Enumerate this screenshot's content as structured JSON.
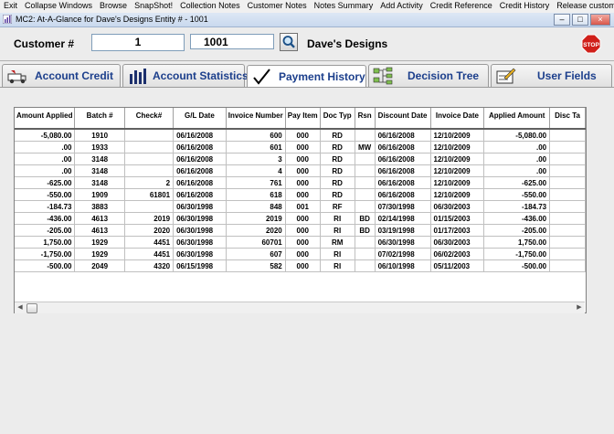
{
  "menu": [
    "Exit",
    "Collapse Windows",
    "Browse",
    "SnapShot!",
    "Collection Notes",
    "Customer Notes",
    "Notes Summary",
    "Add Activity",
    "Credit Reference",
    "Credit History",
    "Release customer from Hold - C"
  ],
  "window": {
    "title": "MC2: At-A-Glance for Dave's Designs     Entity # - 1001"
  },
  "customer": {
    "label": "Customer #",
    "number": "1",
    "entity": "1001",
    "name": "Dave's Designs"
  },
  "tabs": [
    {
      "label": "Account Credit"
    },
    {
      "label": "Account Statistics"
    },
    {
      "label": "Payment History"
    },
    {
      "label": "Decision Tree"
    },
    {
      "label": "User Fields"
    }
  ],
  "grid": {
    "columns": [
      "Amount Applied",
      "Batch #",
      "Check#",
      "G/L Date",
      "Invoice Number",
      "Pay Item",
      "Doc Typ",
      "Rsn",
      "Discount Date",
      "Invoice Date",
      "Applied Amount",
      "Disc Ta"
    ],
    "rows": [
      [
        "-5,080.00",
        "1910",
        "",
        "06/16/2008",
        "600",
        "000",
        "RD",
        "",
        "06/16/2008",
        "12/10/2009",
        "-5,080.00",
        ""
      ],
      [
        ".00",
        "1933",
        "",
        "06/16/2008",
        "601",
        "000",
        "RD",
        "MW",
        "06/16/2008",
        "12/10/2009",
        ".00",
        ""
      ],
      [
        ".00",
        "3148",
        "",
        "06/16/2008",
        "3",
        "000",
        "RD",
        "",
        "06/16/2008",
        "12/10/2009",
        ".00",
        ""
      ],
      [
        ".00",
        "3148",
        "",
        "06/16/2008",
        "4",
        "000",
        "RD",
        "",
        "06/16/2008",
        "12/10/2009",
        ".00",
        ""
      ],
      [
        "-625.00",
        "3148",
        "2",
        "06/16/2008",
        "761",
        "000",
        "RD",
        "",
        "06/16/2008",
        "12/10/2009",
        "-625.00",
        ""
      ],
      [
        "-550.00",
        "1909",
        "61801",
        "06/16/2008",
        "618",
        "000",
        "RD",
        "",
        "06/16/2008",
        "12/10/2009",
        "-550.00",
        ""
      ],
      [
        "-184.73",
        "3883",
        "",
        "06/30/1998",
        "848",
        "001",
        "RF",
        "",
        "07/30/1998",
        "06/30/2003",
        "-184.73",
        ""
      ],
      [
        "-436.00",
        "4613",
        "2019",
        "06/30/1998",
        "2019",
        "000",
        "RI",
        "BD",
        "02/14/1998",
        "01/15/2003",
        "-436.00",
        ""
      ],
      [
        "-205.00",
        "4613",
        "2020",
        "06/30/1998",
        "2020",
        "000",
        "RI",
        "BD",
        "03/19/1998",
        "01/17/2003",
        "-205.00",
        ""
      ],
      [
        "1,750.00",
        "1929",
        "4451",
        "06/30/1998",
        "60701",
        "000",
        "RM",
        "",
        "06/30/1998",
        "06/30/2003",
        "1,750.00",
        ""
      ],
      [
        "-1,750.00",
        "1929",
        "4451",
        "06/30/1998",
        "607",
        "000",
        "RI",
        "",
        "07/02/1998",
        "06/02/2003",
        "-1,750.00",
        ""
      ],
      [
        "-500.00",
        "2049",
        "4320",
        "06/15/1998",
        "582",
        "000",
        "RI",
        "",
        "06/10/1998",
        "05/11/2003",
        "-500.00",
        ""
      ]
    ]
  },
  "colors": {
    "tab_text": "#1c3f8c",
    "title_bg": "#c9d9ee"
  },
  "icons": {
    "window": "app-chart-icon",
    "search": "magnifier-icon",
    "stop": "stop-sign-icon",
    "tab_account_credit": "truck-credit-icon",
    "tab_account_statistics": "bar-chart-icon",
    "tab_payment_history": "checkmark-icon",
    "tab_decision_tree": "tree-nodes-icon",
    "tab_user_fields": "pencil-form-icon"
  }
}
